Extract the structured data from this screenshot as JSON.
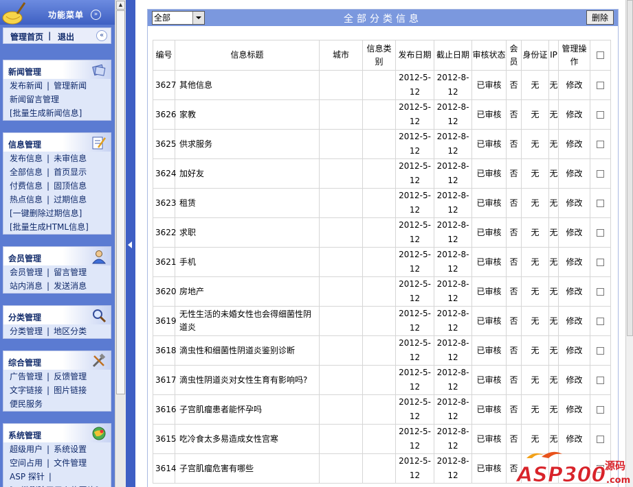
{
  "sidebar": {
    "menu_title": "功能菜单",
    "menu_toggle_glyph": "»",
    "home_link": "管理首页",
    "logout_link": "退出",
    "collapse_glyph": "«",
    "sections": [
      {
        "title": "新闻管理",
        "icon": "news-stack-icon",
        "rows": [
          [
            "发布新闻",
            "管理新闻"
          ],
          [
            "新闻留言管理"
          ],
          [
            "[批量生成新闻信息]"
          ]
        ]
      },
      {
        "title": "信息管理",
        "icon": "edit-document-icon",
        "rows": [
          [
            "发布信息",
            "未审信息"
          ],
          [
            "全部信息",
            "首页显示"
          ],
          [
            "付费信息",
            "固顶信息"
          ],
          [
            "热点信息",
            "过期信息"
          ],
          [
            "[一键删除过期信息]"
          ],
          [
            "[批量生成HTML信息]"
          ]
        ]
      },
      {
        "title": "会员管理",
        "icon": "user-icon",
        "rows": [
          [
            "会员管理",
            "留言管理"
          ],
          [
            "站内消息",
            "发送消息"
          ]
        ]
      },
      {
        "title": "分类管理",
        "icon": "magnifier-icon",
        "rows": [
          [
            "分类管理",
            "地区分类"
          ]
        ]
      },
      {
        "title": "综合管理",
        "icon": "tools-icon",
        "rows": [
          [
            "广告管理",
            "反馈管理"
          ],
          [
            "文字链接",
            "图片链接"
          ],
          [
            "便民服务"
          ]
        ]
      },
      {
        "title": "系统管理",
        "icon": "system-globe-icon",
        "rows": [
          [
            "超级用户",
            "系统设置"
          ],
          [
            "空间占用",
            "文件管理"
          ],
          [
            "ASP 探针",
            ""
          ],
          [
            "[一键删除无用上传图片]"
          ]
        ]
      }
    ]
  },
  "main": {
    "filter_value": "全部",
    "panel_title": "全部分类信息",
    "delete_label": "删除",
    "columns": [
      "编号",
      "信息标题",
      "城市",
      "信息类别",
      "发布日期",
      "截止日期",
      "审核状态",
      "会员",
      "身份证",
      "IP",
      "管理操作",
      ""
    ],
    "rows": [
      {
        "id": "3627",
        "title": "其他信息",
        "city": "",
        "category": "",
        "pub": "2012-5-12",
        "end": "2012-8-12",
        "status": "已审核",
        "member": "否",
        "idcard": "无",
        "ip": "无",
        "op": "修改"
      },
      {
        "id": "3626",
        "title": "家教",
        "city": "",
        "category": "",
        "pub": "2012-5-12",
        "end": "2012-8-12",
        "status": "已审核",
        "member": "否",
        "idcard": "无",
        "ip": "无",
        "op": "修改"
      },
      {
        "id": "3625",
        "title": "供求服务",
        "city": "",
        "category": "",
        "pub": "2012-5-12",
        "end": "2012-8-12",
        "status": "已审核",
        "member": "否",
        "idcard": "无",
        "ip": "无",
        "op": "修改"
      },
      {
        "id": "3624",
        "title": "加好友",
        "city": "",
        "category": "",
        "pub": "2012-5-12",
        "end": "2012-8-12",
        "status": "已审核",
        "member": "否",
        "idcard": "无",
        "ip": "无",
        "op": "修改"
      },
      {
        "id": "3623",
        "title": "租赁",
        "city": "",
        "category": "",
        "pub": "2012-5-12",
        "end": "2012-8-12",
        "status": "已审核",
        "member": "否",
        "idcard": "无",
        "ip": "无",
        "op": "修改"
      },
      {
        "id": "3622",
        "title": "求职",
        "city": "",
        "category": "",
        "pub": "2012-5-12",
        "end": "2012-8-12",
        "status": "已审核",
        "member": "否",
        "idcard": "无",
        "ip": "无",
        "op": "修改"
      },
      {
        "id": "3621",
        "title": "手机",
        "city": "",
        "category": "",
        "pub": "2012-5-12",
        "end": "2012-8-12",
        "status": "已审核",
        "member": "否",
        "idcard": "无",
        "ip": "无",
        "op": "修改"
      },
      {
        "id": "3620",
        "title": "房地产",
        "city": "",
        "category": "",
        "pub": "2012-5-12",
        "end": "2012-8-12",
        "status": "已审核",
        "member": "否",
        "idcard": "无",
        "ip": "无",
        "op": "修改"
      },
      {
        "id": "3619",
        "title": "无性生活的未婚女性也会得细菌性阴道炎",
        "city": "",
        "category": "",
        "pub": "2012-5-12",
        "end": "2012-8-12",
        "status": "已审核",
        "member": "否",
        "idcard": "无",
        "ip": "无",
        "op": "修改"
      },
      {
        "id": "3618",
        "title": "滴虫性和细菌性阴道炎鉴别诊断",
        "city": "",
        "category": "",
        "pub": "2012-5-12",
        "end": "2012-8-12",
        "status": "已审核",
        "member": "否",
        "idcard": "无",
        "ip": "无",
        "op": "修改"
      },
      {
        "id": "3617",
        "title": "滴虫性阴道炎对女性生育有影响吗?",
        "city": "",
        "category": "",
        "pub": "2012-5-12",
        "end": "2012-8-12",
        "status": "已审核",
        "member": "否",
        "idcard": "无",
        "ip": "无",
        "op": "修改"
      },
      {
        "id": "3616",
        "title": "子宫肌瘤患者能怀孕吗",
        "city": "",
        "category": "",
        "pub": "2012-5-12",
        "end": "2012-8-12",
        "status": "已审核",
        "member": "否",
        "idcard": "无",
        "ip": "无",
        "op": "修改"
      },
      {
        "id": "3615",
        "title": "吃冷食太多易造成女性宫寒",
        "city": "",
        "category": "",
        "pub": "2012-5-12",
        "end": "2012-8-12",
        "status": "已审核",
        "member": "否",
        "idcard": "无",
        "ip": "无",
        "op": "修改"
      },
      {
        "id": "3614",
        "title": "子宫肌瘤危害有哪些",
        "city": "",
        "category": "",
        "pub": "2012-5-12",
        "end": "2012-8-12",
        "status": "已审核",
        "member": "否",
        "idcard": "",
        "ip": "",
        "op": ""
      }
    ]
  },
  "watermark": {
    "brand": "ASP300",
    "suffix": "源码",
    "url": ".com"
  },
  "colors": {
    "sidebar_bg": "#5b7bd2",
    "titlebar": "#7b98de",
    "approved_green": "#2b8a1d",
    "watermark_red": "#d8232a"
  }
}
